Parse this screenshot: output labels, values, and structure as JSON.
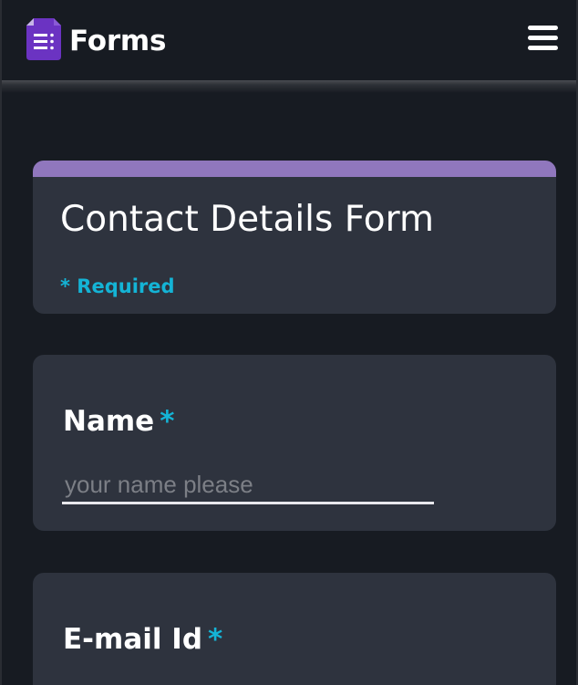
{
  "header": {
    "app_title": "Forms",
    "logo_icon": "google-forms-icon",
    "menu_icon": "hamburger-menu-icon"
  },
  "form": {
    "title": "Contact Details Form",
    "required_note": "* Required",
    "accent_color": "#9077bd",
    "required_color": "#14b4d6"
  },
  "fields": [
    {
      "label": "Name",
      "required_marker": "*",
      "placeholder": "your name please",
      "value": ""
    },
    {
      "label": "E-mail Id",
      "required_marker": "*"
    }
  ]
}
